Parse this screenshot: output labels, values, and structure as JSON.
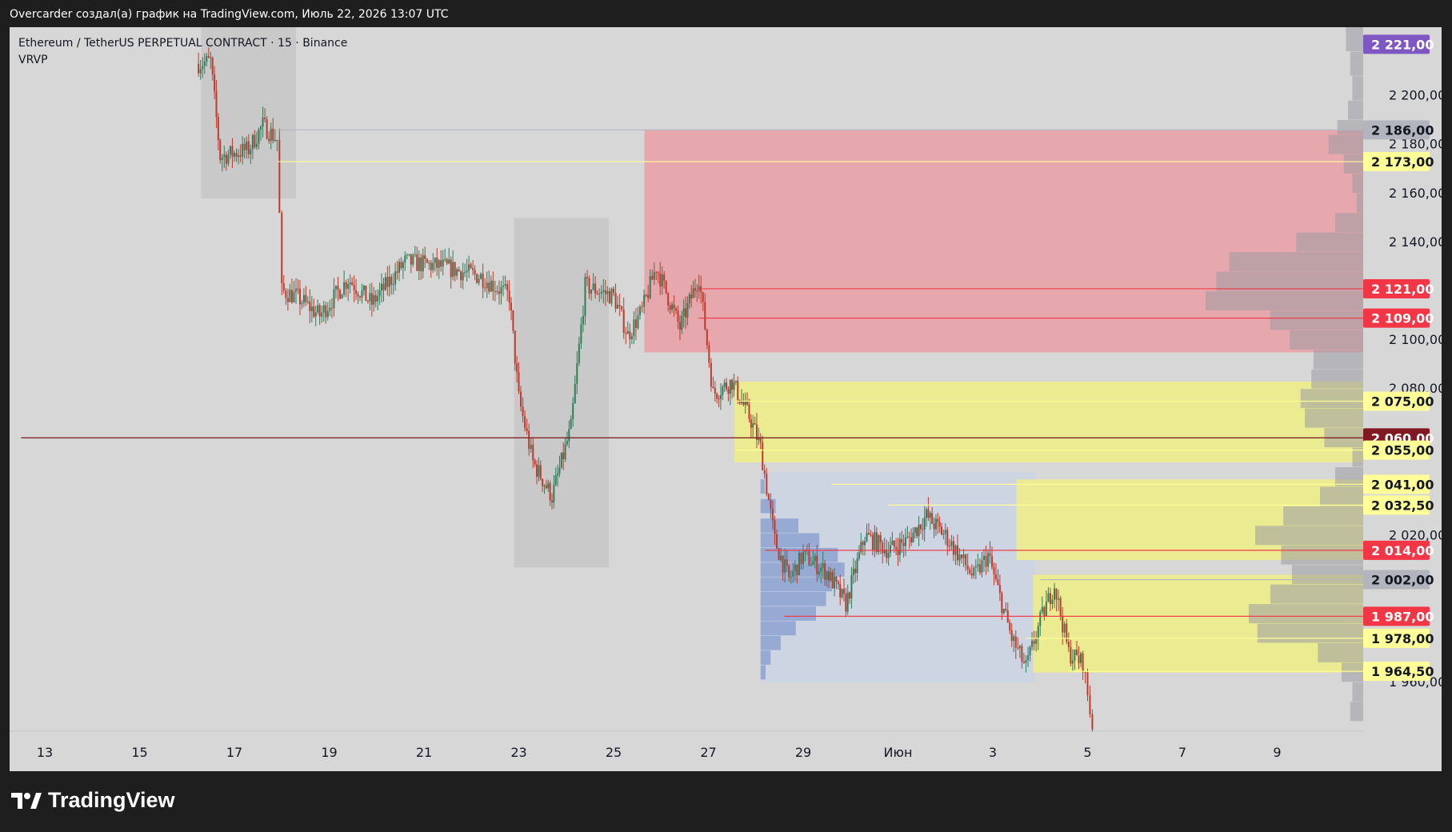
{
  "header": {
    "caption": "Overcarder создал(а) график на TradingView.com, Июль 22, 2026 13:07 UTC"
  },
  "legend": {
    "symbol": "Ethereum / TetherUS PERPETUAL CONTRACT · 15 · Binance",
    "indicator": "VRVP"
  },
  "brand": {
    "name": "TradingView"
  },
  "colors": {
    "plot_bg": "#d7d7d7",
    "frame_bg": "#1e1e1e",
    "candle_up": "#2e7d5b",
    "candle_down": "#c0392b",
    "supply_zone": "#e9a0a4",
    "demand_zone": "#eeee86",
    "volume_profile_blue": "#6b86c6",
    "red_label": "#f23645",
    "dark_red_label": "#801922",
    "yellow_label": "#ffff99",
    "gray_label": "#b2b5be",
    "purple_label": "#7e57c2"
  },
  "chart_data": {
    "type": "candlestick",
    "title": "Ethereum / TetherUS PERPETUAL CONTRACT",
    "timeframe": "15",
    "exchange": "Binance",
    "ylim": [
      1940,
      2228
    ],
    "y_ticks": [
      "2 200,00",
      "2 180,00",
      "2 160,00",
      "2 140,00",
      "2 100,00",
      "2 080,00",
      "2 020,00",
      "1 960,00"
    ],
    "x_ticks": [
      "13",
      "15",
      "17",
      "19",
      "21",
      "23",
      "25",
      "27",
      "29",
      "Июн",
      "3",
      "5",
      "7",
      "9"
    ],
    "price_path_keypoints": [
      {
        "day": 16.2,
        "price": 2213
      },
      {
        "day": 16.5,
        "price": 2214
      },
      {
        "day": 16.7,
        "price": 2175
      },
      {
        "day": 17.3,
        "price": 2178
      },
      {
        "day": 17.6,
        "price": 2188
      },
      {
        "day": 17.9,
        "price": 2182
      },
      {
        "day": 18.0,
        "price": 2120
      },
      {
        "day": 18.3,
        "price": 2118
      },
      {
        "day": 18.8,
        "price": 2110
      },
      {
        "day": 19.4,
        "price": 2125
      },
      {
        "day": 19.9,
        "price": 2115
      },
      {
        "day": 20.6,
        "price": 2132
      },
      {
        "day": 21.4,
        "price": 2130
      },
      {
        "day": 22.2,
        "price": 2126
      },
      {
        "day": 22.8,
        "price": 2118
      },
      {
        "day": 23.0,
        "price": 2076
      },
      {
        "day": 23.3,
        "price": 2050
      },
      {
        "day": 23.7,
        "price": 2036
      },
      {
        "day": 24.1,
        "price": 2064
      },
      {
        "day": 24.4,
        "price": 2122
      },
      {
        "day": 25.0,
        "price": 2118
      },
      {
        "day": 25.3,
        "price": 2102
      },
      {
        "day": 25.6,
        "price": 2112
      },
      {
        "day": 25.9,
        "price": 2130
      },
      {
        "day": 26.4,
        "price": 2105
      },
      {
        "day": 26.8,
        "price": 2126
      },
      {
        "day": 27.1,
        "price": 2078
      },
      {
        "day": 27.5,
        "price": 2083
      },
      {
        "day": 27.9,
        "price": 2067
      },
      {
        "day": 28.1,
        "price": 2056
      },
      {
        "day": 28.4,
        "price": 2018
      },
      {
        "day": 28.7,
        "price": 2002
      },
      {
        "day": 29.0,
        "price": 2012
      },
      {
        "day": 29.5,
        "price": 2005
      },
      {
        "day": 29.9,
        "price": 1992
      },
      {
        "day": 30.3,
        "price": 2020
      },
      {
        "day": 30.8,
        "price": 2014
      },
      {
        "day": 31.2,
        "price": 2018
      },
      {
        "day": 31.6,
        "price": 2028
      },
      {
        "day": 32.0,
        "price": 2020
      },
      {
        "day": 32.6,
        "price": 2003
      },
      {
        "day": 32.9,
        "price": 2012
      },
      {
        "day": 33.4,
        "price": 1978
      },
      {
        "day": 33.7,
        "price": 1966
      },
      {
        "day": 34.0,
        "price": 1985
      },
      {
        "day": 34.3,
        "price": 2000
      },
      {
        "day": 34.6,
        "price": 1972
      },
      {
        "day": 34.9,
        "price": 1968
      },
      {
        "day": 35.0,
        "price": 1955
      },
      {
        "day": 35.1,
        "price": 1942
      }
    ],
    "zones": [
      {
        "name": "supply-zone",
        "color": "#e9a0a4",
        "from_day": 25.65,
        "price_top": 2186,
        "price_bottom": 2095
      },
      {
        "name": "demand-zone-upper",
        "color": "#eeee86",
        "from_day": 27.55,
        "price_top": 2083,
        "price_bottom": 2050
      },
      {
        "name": "demand-zone-mid",
        "color": "#eeee86",
        "from_day": 33.5,
        "price_top": 2043,
        "price_bottom": 2010
      },
      {
        "name": "demand-zone-lower",
        "color": "#eeee86",
        "from_day": 33.85,
        "price_top": 2004,
        "price_bottom": 1964
      }
    ],
    "range_boxes": [
      {
        "name": "range-box-1",
        "from_day": 16.3,
        "to_day": 18.3,
        "price_top": 2228,
        "price_bottom": 2158
      },
      {
        "name": "range-box-2",
        "from_day": 22.9,
        "to_day": 24.9,
        "price_top": 2150,
        "price_bottom": 2007
      },
      {
        "name": "range-box-3",
        "from_day": 28.1,
        "to_day": 33.9,
        "price_top": 2046,
        "price_bottom": 1960
      }
    ],
    "price_lines": [
      {
        "price": 2186.0,
        "label": "2 186,00",
        "color": "#b2b5be",
        "from_day": 17.9
      },
      {
        "price": 2173.0,
        "label": "2 173,00",
        "color": "#ffff99",
        "from_day": 17.9
      },
      {
        "price": 2121.0,
        "label": "2 121,00",
        "color": "#f23645",
        "from_day": 26.8
      },
      {
        "price": 2109.0,
        "label": "2 109,00",
        "color": "#f23645",
        "from_day": 26.8
      },
      {
        "price": 2075.0,
        "label": "2 075,00",
        "color": "#ffff99",
        "from_day": 27.6
      },
      {
        "price": 2060.0,
        "label": "2 060,00",
        "color": "#801922",
        "from_day": 12.5
      },
      {
        "price": 2055.0,
        "label": "2 055,00",
        "color": "#ffff99",
        "from_day": 27.6
      },
      {
        "price": 2041.0,
        "label": "2 041,00",
        "color": "#ffff99",
        "from_day": 29.6
      },
      {
        "price": 2032.5,
        "label": "2 032,50",
        "color": "#ffff99",
        "from_day": 30.8
      },
      {
        "price": 2014.0,
        "label": "2 014,00",
        "color": "#f23645",
        "from_day": 28.2
      },
      {
        "price": 2002.0,
        "label": "2 002,00",
        "color": "#b2b5be",
        "from_day": 34.0
      },
      {
        "price": 1987.0,
        "label": "1 987,00",
        "color": "#f23645",
        "from_day": 28.6
      },
      {
        "price": 1978.0,
        "label": "1 978,00",
        "color": "#ffff99",
        "from_day": 33.7
      },
      {
        "price": 1964.5,
        "label": "1 964,50",
        "color": "#ffff99",
        "from_day": 34.6
      }
    ],
    "current_price": {
      "price": 2221.0,
      "label": "2 221,00",
      "color": "#7e57c2"
    },
    "volume_profile_side": [
      {
        "price_top": 2228,
        "price_bottom": 2218,
        "volume": 0.08
      },
      {
        "price_top": 2218,
        "price_bottom": 2208,
        "volume": 0.06
      },
      {
        "price_top": 2208,
        "price_bottom": 2198,
        "volume": 0.05
      },
      {
        "price_top": 2198,
        "price_bottom": 2190,
        "volume": 0.07
      },
      {
        "price_top": 2190,
        "price_bottom": 2184,
        "volume": 0.12
      },
      {
        "price_top": 2184,
        "price_bottom": 2176,
        "volume": 0.16
      },
      {
        "price_top": 2176,
        "price_bottom": 2168,
        "volume": 0.09
      },
      {
        "price_top": 2168,
        "price_bottom": 2160,
        "volume": 0.05
      },
      {
        "price_top": 2160,
        "price_bottom": 2152,
        "volume": 0.03
      },
      {
        "price_top": 2152,
        "price_bottom": 2144,
        "volume": 0.13
      },
      {
        "price_top": 2144,
        "price_bottom": 2136,
        "volume": 0.31
      },
      {
        "price_top": 2136,
        "price_bottom": 2128,
        "volume": 0.62
      },
      {
        "price_top": 2128,
        "price_bottom": 2120,
        "volume": 0.68
      },
      {
        "price_top": 2120,
        "price_bottom": 2112,
        "volume": 0.73
      },
      {
        "price_top": 2112,
        "price_bottom": 2104,
        "volume": 0.43
      },
      {
        "price_top": 2104,
        "price_bottom": 2096,
        "volume": 0.34
      },
      {
        "price_top": 2096,
        "price_bottom": 2088,
        "volume": 0.23
      },
      {
        "price_top": 2088,
        "price_bottom": 2080,
        "volume": 0.24
      },
      {
        "price_top": 2080,
        "price_bottom": 2072,
        "volume": 0.29
      },
      {
        "price_top": 2072,
        "price_bottom": 2064,
        "volume": 0.27
      },
      {
        "price_top": 2064,
        "price_bottom": 2056,
        "volume": 0.18
      },
      {
        "price_top": 2056,
        "price_bottom": 2048,
        "volume": 0.05
      },
      {
        "price_top": 2048,
        "price_bottom": 2040,
        "volume": 0.13
      },
      {
        "price_top": 2040,
        "price_bottom": 2032,
        "volume": 0.2
      },
      {
        "price_top": 2032,
        "price_bottom": 2024,
        "volume": 0.37
      },
      {
        "price_top": 2024,
        "price_bottom": 2016,
        "volume": 0.5
      },
      {
        "price_top": 2016,
        "price_bottom": 2008,
        "volume": 0.38
      },
      {
        "price_top": 2008,
        "price_bottom": 2000,
        "volume": 0.33
      },
      {
        "price_top": 2000,
        "price_bottom": 1992,
        "volume": 0.43
      },
      {
        "price_top": 1992,
        "price_bottom": 1984,
        "volume": 0.53
      },
      {
        "price_top": 1984,
        "price_bottom": 1976,
        "volume": 0.49
      },
      {
        "price_top": 1976,
        "price_bottom": 1968,
        "volume": 0.21
      },
      {
        "price_top": 1968,
        "price_bottom": 1960,
        "volume": 0.1
      },
      {
        "price_top": 1960,
        "price_bottom": 1952,
        "volume": 0.05
      },
      {
        "price_top": 1952,
        "price_bottom": 1944,
        "volume": 0.06
      }
    ],
    "volume_profile_range": {
      "from_day": 28.1,
      "rows": [
        {
          "price": 2040,
          "volume": 0.05
        },
        {
          "price": 2032,
          "volume": 0.18
        },
        {
          "price": 2024,
          "volume": 0.45
        },
        {
          "price": 2018,
          "volume": 0.7
        },
        {
          "price": 2012,
          "volume": 0.92
        },
        {
          "price": 2006,
          "volume": 1.0
        },
        {
          "price": 2000,
          "volume": 0.85
        },
        {
          "price": 1994,
          "volume": 0.78
        },
        {
          "price": 1988,
          "volume": 0.66
        },
        {
          "price": 1982,
          "volume": 0.42
        },
        {
          "price": 1976,
          "volume": 0.24
        },
        {
          "price": 1970,
          "volume": 0.12
        },
        {
          "price": 1964,
          "volume": 0.06
        }
      ]
    }
  }
}
